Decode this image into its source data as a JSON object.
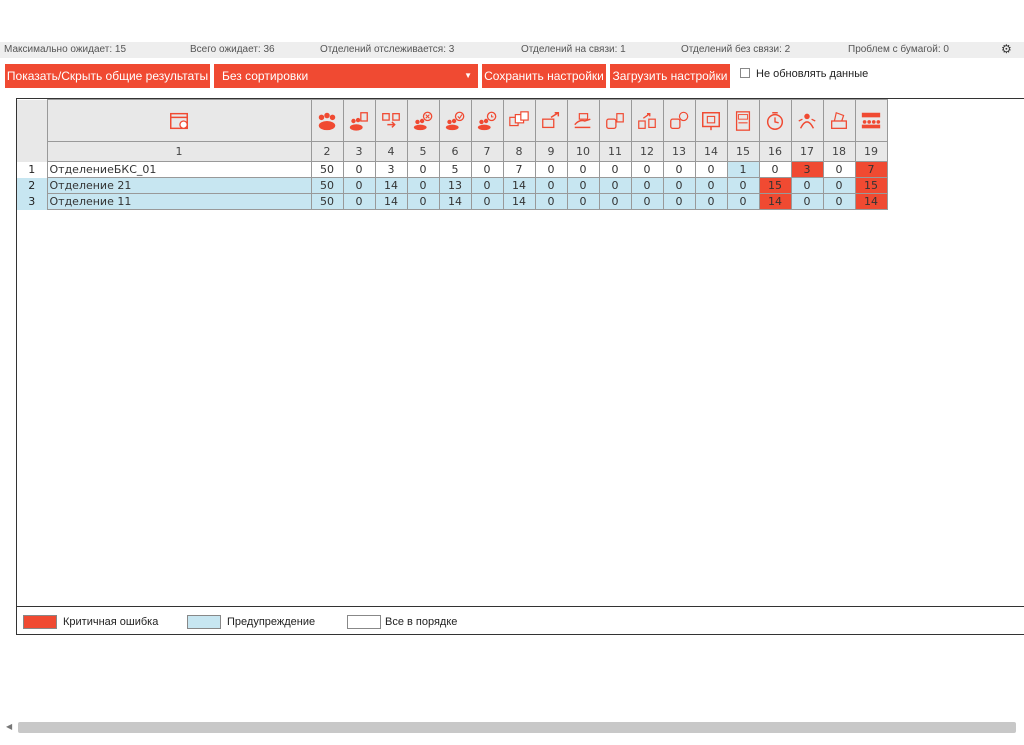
{
  "status": {
    "max_wait": "Максимально ожидает: 15",
    "total_wait": "Всего ожидает: 36",
    "tracked": "Отделений отслеживается: 3",
    "online": "Отделений на связи: 1",
    "offline": "Отделений без связи: 2",
    "paper": "Проблем с бумагой: 0"
  },
  "toolbar": {
    "toggle_label": "Показать/Скрыть общие результаты",
    "sort_value": "Без сортировки",
    "save_label": "Сохранить настройки",
    "load_label": "Загрузить настройки",
    "no_update_label": "Не обновлять данные"
  },
  "colors": {
    "accent": "#f04a32",
    "warning": "#c7e6f1",
    "ok": "#ffffff"
  },
  "table": {
    "column_numbers": [
      "1",
      "2",
      "3",
      "4",
      "5",
      "6",
      "7",
      "8",
      "9",
      "10",
      "11",
      "12",
      "13",
      "14",
      "15",
      "16",
      "17",
      "18",
      "19"
    ],
    "column_icons": [
      "calendar-icon",
      "people-group-icon",
      "people-list-icon",
      "people-transfer-icon",
      "people-cancel-icon",
      "people-check-icon",
      "people-clock-icon",
      "queue-screens-icon",
      "monitor-transfer-icon",
      "hand-cash-icon",
      "terminal-add-icon",
      "window-transfer-icon",
      "terminal-ok-icon",
      "display-board-icon",
      "ticket-counter-icon",
      "timer-alarm-icon",
      "operator-alert-icon",
      "printer-paper-icon",
      "waiting-crowd-icon"
    ],
    "rows": [
      {
        "index": "1",
        "name": "ОтделениеБКС_01",
        "cells": [
          "50",
          "0",
          "3",
          "0",
          "5",
          "0",
          "7",
          "0",
          "0",
          "0",
          "0",
          "0",
          "0",
          "1",
          "0",
          "3",
          "0",
          "7"
        ],
        "states": [
          "",
          "",
          "",
          "",
          "",
          "",
          "",
          "",
          "",
          "",
          "",
          "",
          "",
          "warn",
          "ok",
          "crit",
          "",
          "crit"
        ]
      },
      {
        "index": "2",
        "name": "Отделение 21",
        "cells": [
          "50",
          "0",
          "14",
          "0",
          "13",
          "0",
          "14",
          "0",
          "0",
          "0",
          "0",
          "0",
          "0",
          "0",
          "15",
          "0",
          "0",
          "15"
        ],
        "states": [
          "",
          "",
          "",
          "",
          "",
          "",
          "",
          "",
          "",
          "",
          "",
          "",
          "",
          "",
          "crit",
          "",
          "",
          "crit"
        ]
      },
      {
        "index": "3",
        "name": "Отделение 11",
        "cells": [
          "50",
          "0",
          "14",
          "0",
          "14",
          "0",
          "14",
          "0",
          "0",
          "0",
          "0",
          "0",
          "0",
          "0",
          "14",
          "0",
          "0",
          "14"
        ],
        "states": [
          "",
          "",
          "",
          "",
          "",
          "",
          "",
          "",
          "",
          "",
          "",
          "",
          "",
          "",
          "crit",
          "",
          "",
          "crit"
        ]
      }
    ]
  },
  "legend": {
    "critical": "Критичная ошибка",
    "warning": "Предупреждение",
    "ok": "Все в порядке"
  }
}
